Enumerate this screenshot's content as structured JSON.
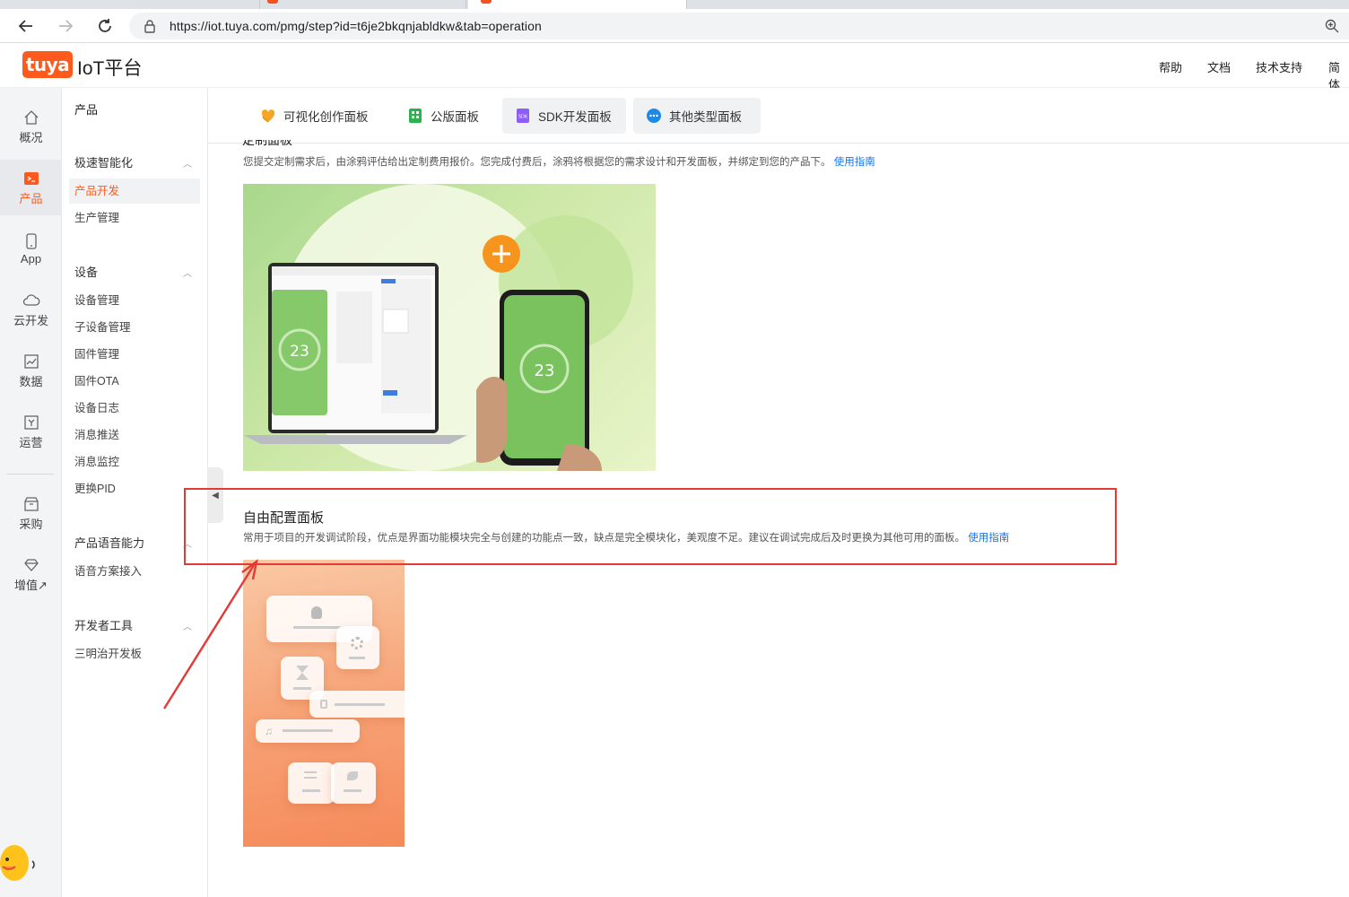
{
  "browser": {
    "url": "https://iot.tuya.com/pmg/step?id=t6je2bkqnjabldkw&tab=operation"
  },
  "header": {
    "logo": "tuya",
    "platform_name": "IoT平台",
    "links": [
      "帮助",
      "文档",
      "技术支持",
      "简体"
    ]
  },
  "rail": {
    "items": [
      {
        "label": "概况",
        "icon": "home-icon"
      },
      {
        "label": "产品",
        "icon": "terminal-icon"
      },
      {
        "label": "App",
        "icon": "phone-icon"
      },
      {
        "label": "云开发",
        "icon": "cloud-icon"
      },
      {
        "label": "数据",
        "icon": "chart-icon"
      },
      {
        "label": "运营",
        "icon": "bookmark-icon"
      },
      {
        "label": "采购",
        "icon": "box-icon"
      },
      {
        "label": "增值↗",
        "icon": "diamond-icon"
      }
    ],
    "active_index": 1,
    "accent": "#ff5a1e"
  },
  "submenu": {
    "title": "产品",
    "groups": [
      {
        "label": "极速智能化",
        "items": [
          "产品开发",
          "生产管理"
        ]
      },
      {
        "label": "设备",
        "items": [
          "设备管理",
          "子设备管理",
          "固件管理",
          "固件OTA",
          "设备日志",
          "消息推送",
          "消息监控",
          "更换PID"
        ]
      },
      {
        "label": "产品语音能力",
        "items": [
          "语音方案接入"
        ]
      },
      {
        "label": "开发者工具",
        "items": [
          "三明治开发板"
        ]
      }
    ],
    "active_item": "产品开发"
  },
  "panel_tabs": [
    {
      "label": "可视化创作面板",
      "icon": "heart-hands-icon"
    },
    {
      "label": "公版面板",
      "icon": "grid-icon"
    },
    {
      "label": "SDK开发面板",
      "icon": "sdk-icon"
    },
    {
      "label": "其他类型面板",
      "icon": "more-icon"
    }
  ],
  "custom_panel": {
    "description": "您提交定制需求后，由涂鸦评估给出定制费用报价。您完成付费后，涂鸦将根据您的需求设计和开发面板，并绑定到您的产品下。",
    "guide_link": "使用指南",
    "thermostat_value": "23"
  },
  "free_panel": {
    "title": "自由配置面板",
    "description": "常用于项目的开发调试阶段，优点是界面功能模块完全与创建的功能点一致，缺点是完全模块化，美观度不足。建议在调试完成后及时更换为其他可用的面板。",
    "guide_link": "使用指南"
  },
  "annotation": {
    "highlight_color": "#e53935"
  }
}
